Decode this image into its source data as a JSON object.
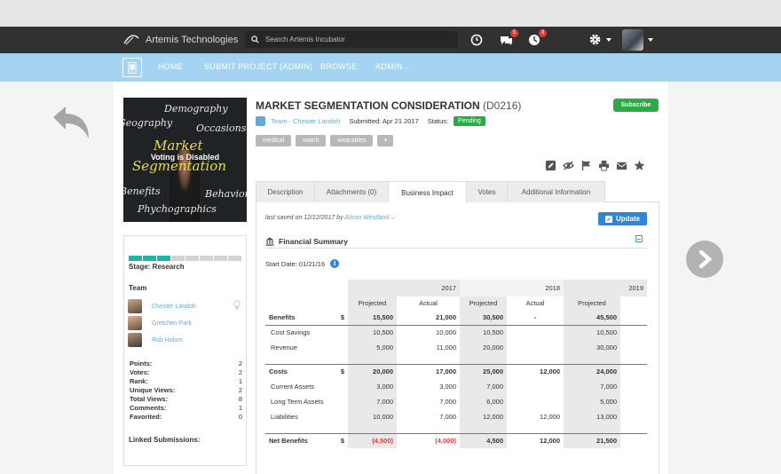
{
  "app": {
    "name": "Artemis Technologies",
    "search_placeholder": "Search Artemis Incubator",
    "notifications": {
      "messages": "5",
      "alerts": "3"
    }
  },
  "nav": {
    "items": [
      "HOME",
      "SUBMIT PROJECT (ADMIN)",
      "BROWSE",
      "ADMIN"
    ]
  },
  "project": {
    "title": "MARKET SEGMENTATION CONSIDERATION",
    "code": "(D0216)",
    "subscribe_label": "Subscribe",
    "team_label": "Team - Chester Landoh",
    "submitted": "Submitted: Apr 21 2017",
    "status_label": "Status:",
    "status": "Pending",
    "tags": [
      "medical",
      "watch",
      "wearables",
      "+"
    ]
  },
  "thumbnail": {
    "overlay": "Voting is Disabled",
    "words": [
      "Demography",
      "Geography",
      "Occasions",
      "Market",
      "Segmentation",
      "Benefits",
      "Behavior",
      "Phychographics"
    ]
  },
  "sidebar": {
    "stage_segments": 8,
    "stage_filled": 3,
    "stage_label": "Stage: Research",
    "team_title": "Team",
    "team": [
      "Chester Landoh",
      "Gretchen Park",
      "Rob Holom"
    ],
    "stats": [
      {
        "label": "Points:",
        "value": "2"
      },
      {
        "label": "Votes:",
        "value": "2"
      },
      {
        "label": "Rank:",
        "value": "1"
      },
      {
        "label": "Unique Views:",
        "value": "2"
      },
      {
        "label": "Total Views:",
        "value": "8"
      },
      {
        "label": "Comments:",
        "value": "1"
      },
      {
        "label": "Favorited:",
        "value": "0"
      }
    ],
    "linked_label": "Linked Submissions:"
  },
  "tabs": [
    "Description",
    "Attachments (0)",
    "Business Impact",
    "Votes",
    "Additional Information"
  ],
  "active_tab": "Business Impact",
  "business_impact": {
    "saved_prefix": "last saved on 12/12/2017 by",
    "saved_by": "Alison Westland",
    "update_label": "Update",
    "section_title": "Financial Summary",
    "start_date": "Start Date: 01/21/16",
    "years": [
      "2017",
      "2018",
      "2019"
    ],
    "col_headers": [
      "Projected",
      "Actual",
      "Projected",
      "Actual",
      "Projected"
    ],
    "rows": [
      {
        "label": "Benefits",
        "unit": "$",
        "values": [
          "15,500",
          "21,000",
          "30,500",
          "-",
          "45,500"
        ],
        "bold": true
      },
      {
        "label": "Cost Savings",
        "unit": "",
        "values": [
          "10,500",
          "10,000",
          "10,500",
          "",
          "10,500"
        ]
      },
      {
        "label": "Revenue",
        "unit": "",
        "values": [
          "5,000",
          "11,000",
          "20,000",
          "",
          "30,000"
        ]
      },
      {
        "label": "Costs",
        "unit": "$",
        "values": [
          "20,000",
          "17,000",
          "25,000",
          "12,000",
          "24,000"
        ],
        "bold": true
      },
      {
        "label": "Current Assets",
        "unit": "",
        "values": [
          "3,000",
          "3,000",
          "7,000",
          "",
          "7,000"
        ]
      },
      {
        "label": "Long Term Assets",
        "unit": "",
        "values": [
          "7,000",
          "7,000",
          "6,000",
          "",
          "5,000"
        ]
      },
      {
        "label": "Liabilities",
        "unit": "",
        "values": [
          "10,000",
          "7,000",
          "12,000",
          "12,000",
          "13,000"
        ]
      },
      {
        "label": "Net Benefits",
        "unit": "$",
        "values": [
          "(4,500)",
          "(4,000)",
          "4,500",
          "12,000",
          "21,500"
        ],
        "bold": true
      }
    ]
  },
  "colors": {
    "accent": "#2bab46",
    "nav": "#a4d4f1",
    "topbar": "#313131",
    "link": "#63a8d8",
    "negative": "#e53935",
    "stage": "#1fb59f"
  }
}
